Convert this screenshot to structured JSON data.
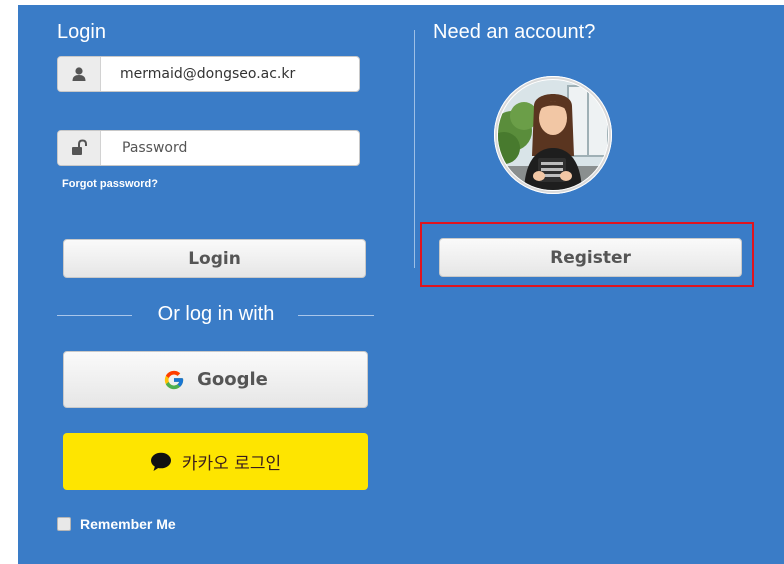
{
  "login": {
    "title": "Login",
    "email_value": "mermaid@dongseo.ac.kr",
    "password_placeholder": "Password",
    "forgot_label": "Forgot password?",
    "login_button": "Login",
    "or_label": "Or log in with",
    "google_button": "Google",
    "kakao_button": "카카오 로그인",
    "remember_label": "Remember Me"
  },
  "register": {
    "title": "Need an account?",
    "register_button": "Register"
  },
  "icons": {
    "email_field": "user-icon",
    "password_field": "lock-open-icon",
    "google": "google-icon",
    "kakao": "kakao-chat-bubble-icon",
    "avatar": "avatar-image"
  },
  "colors": {
    "panel_background": "#3a7cc7",
    "kakao_yellow": "#fee500",
    "highlight_red": "#e0141e"
  }
}
